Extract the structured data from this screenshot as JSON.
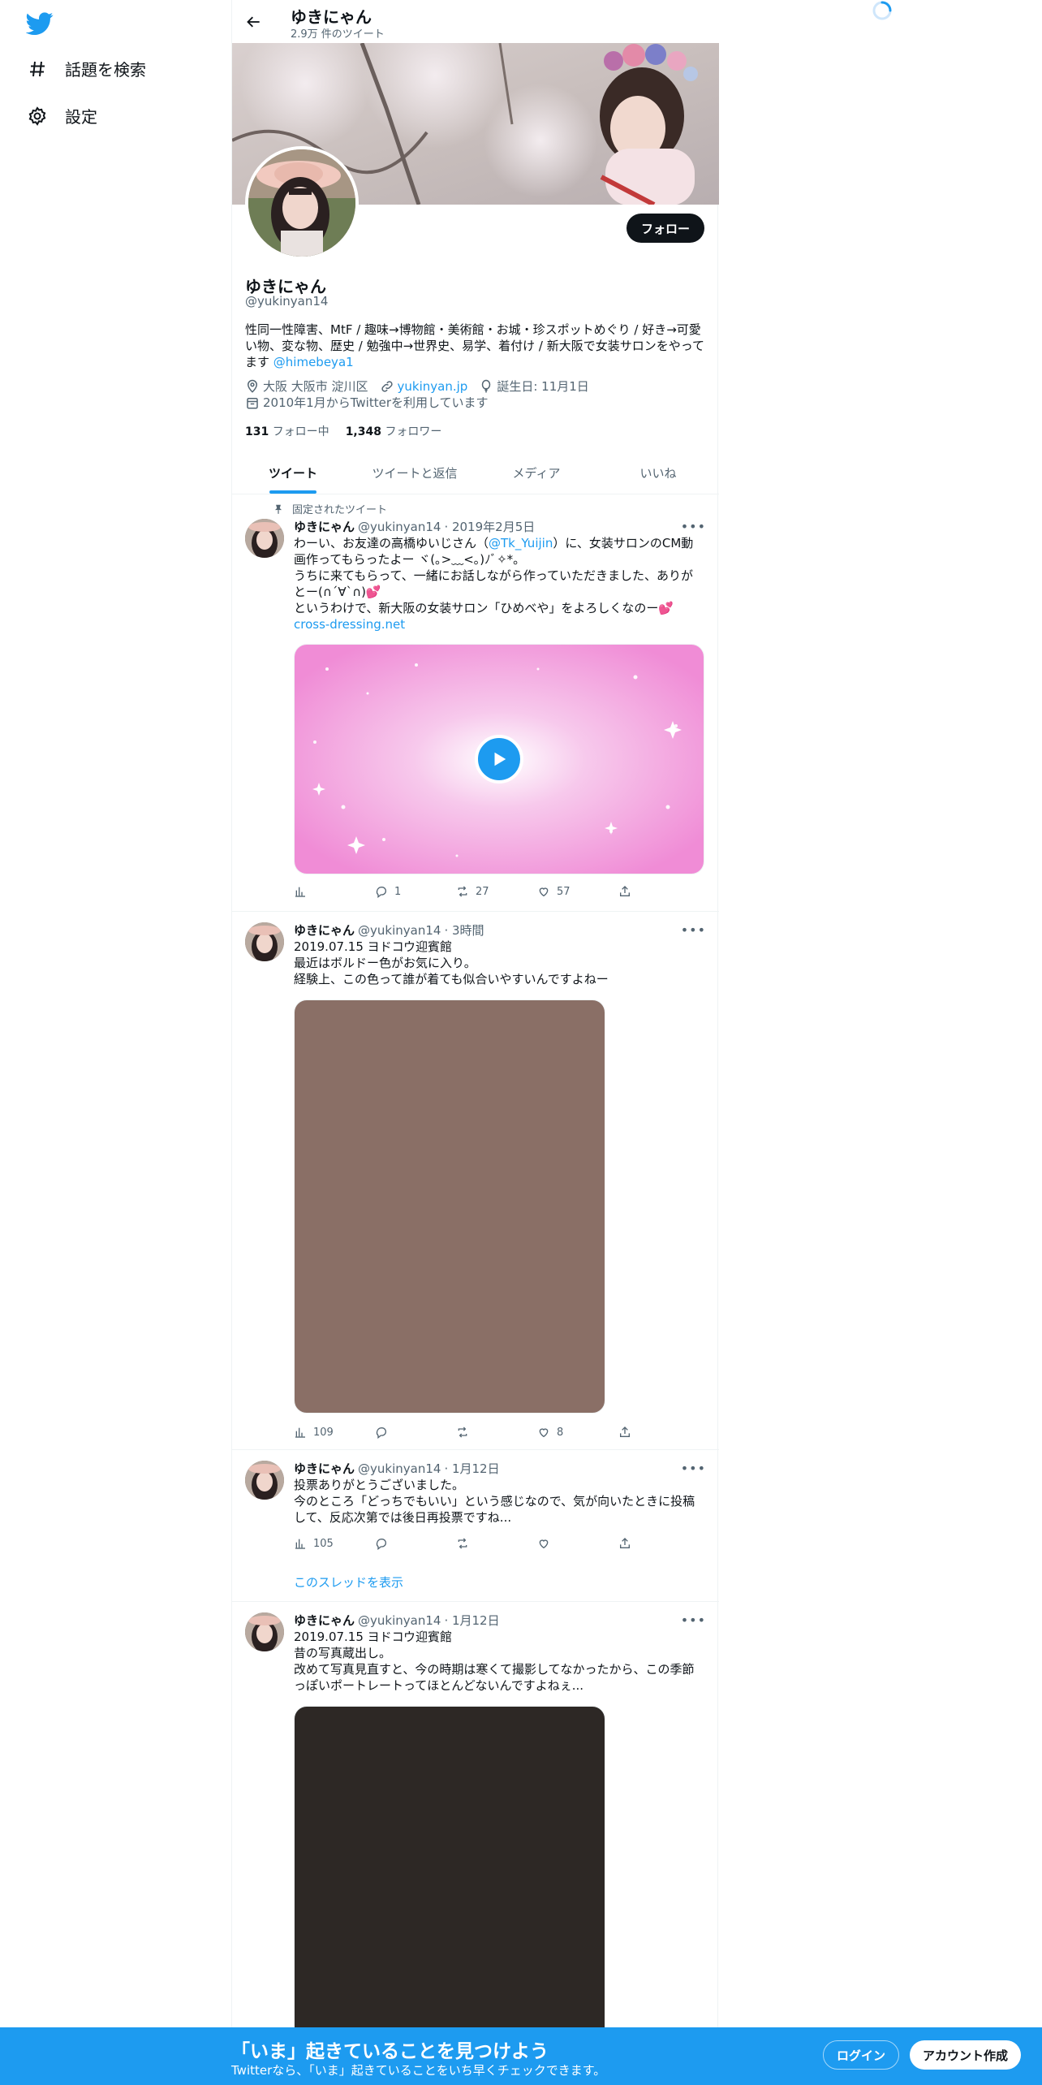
{
  "nav": {
    "explore_label": "話題を検索",
    "settings_label": "設定"
  },
  "header": {
    "name": "ゆきにゃん",
    "tweet_count": "2.9万 件のツイート"
  },
  "profile": {
    "follow_label": "フォロー",
    "name": "ゆきにゃん",
    "handle": "@yukinyan14",
    "bio": "性同一性障害、MtF / 趣味→博物館・美術館・お城・珍スポットめぐり / 好き→可愛い物、変な物、歴史 / 勉強中→世界史、易学、着付け / 新大阪で女装サロンをやってます",
    "bio_mention": "@himebeya1",
    "location": "大阪 大阪市 淀川区",
    "website": "yukinyan.jp",
    "birthday": "誕生日: 11月1日",
    "joined": "2010年1月からTwitterを利用しています",
    "following_count": "131",
    "following_label": "フォロー中",
    "followers_count": "1,348",
    "followers_label": "フォロワー"
  },
  "tabs": [
    "ツイート",
    "ツイートと返信",
    "メディア",
    "いいね"
  ],
  "tweets": [
    {
      "pinned_label": "固定されたツイート",
      "name": "ゆきにゃん",
      "handle": "@yukinyan14",
      "time": "· 2019年2月5日",
      "text_a": "わーい、お友達の高橋ゆいじさん（",
      "mention": "@Tk_Yuijin",
      "text_b": "）に、女装サロンのCM動画作ってもらったよー ヾ(｡>﹏<｡)ﾉﾞ✧*。\nうちに来てもらって、一緒にお話しながら作っていただきました、ありがとー(∩´∀`∩)💕\nというわけで、新大阪の女装サロン「ひめべや」をよろしくなのー💕",
      "link": "cross-dressing.net",
      "views": "",
      "replies": "1",
      "retweets": "27",
      "likes": "57"
    },
    {
      "name": "ゆきにゃん",
      "handle": "@yukinyan14",
      "time": "· 3時間",
      "text": "2019.07.15 ヨドコウ迎賓館\n最近はボルドー色がお気に入り。\n経験上、この色って誰が着ても似合いやすいんですよねー",
      "views": "109",
      "replies": "",
      "retweets": "",
      "likes": "8"
    },
    {
      "name": "ゆきにゃん",
      "handle": "@yukinyan14",
      "time": "· 1月12日",
      "text": "投票ありがとうございました。\n今のところ「どっちでもいい」という感じなので、気が向いたときに投稿して、反応次第では後日再投票ですね...",
      "views": "105",
      "replies": "",
      "retweets": "",
      "likes": "",
      "thread_label": "このスレッドを表示"
    },
    {
      "name": "ゆきにゃん",
      "handle": "@yukinyan14",
      "time": "· 1月12日",
      "text": "2019.07.15 ヨドコウ迎賓館\n昔の写真蔵出し。\n改めて写真見直すと、今の時期は寒くて撮影してなかったから、この季節っぽいポートレートってほとんどないんですよねぇ..."
    }
  ],
  "bottom": {
    "title": "「いま」起きていることを見つけよう",
    "subtitle": "Twitterなら、「いま」起きていることをいち早くチェックできます。",
    "login_label": "ログイン",
    "signup_label": "アカウント作成"
  },
  "colors": {
    "accent": "#1d9bf0",
    "text": "#0f1419",
    "muted": "#536471",
    "media_photo_1": "#8a6f66",
    "media_photo_2": "#2d2825"
  }
}
